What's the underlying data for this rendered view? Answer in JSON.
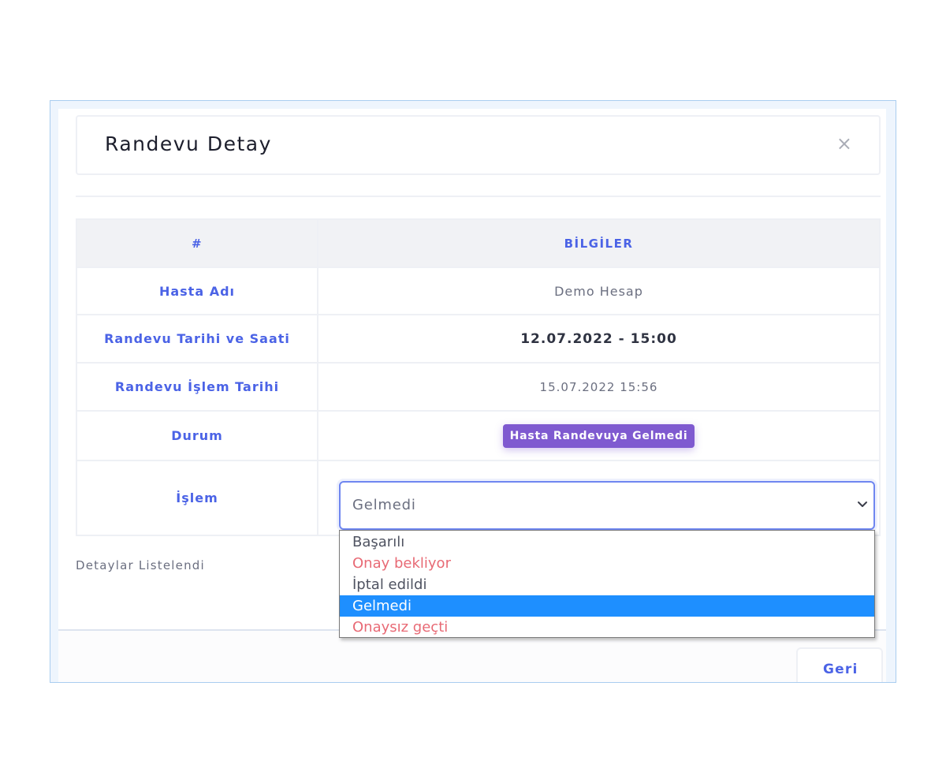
{
  "modal": {
    "title": "Randevu Detay",
    "close_label": "×",
    "footer_note": "Detaylar Listelendi",
    "back_label": "Geri"
  },
  "table": {
    "headers": [
      "#",
      "BİLGİLER"
    ],
    "rows": [
      {
        "key": "Hasta Adı",
        "value": "Demo Hesap"
      },
      {
        "key": "Randevu Tarihi ve Saati",
        "value": "12.07.2022 - 15:00"
      },
      {
        "key": "Randevu İşlem Tarihi",
        "value": "15.07.2022 15:56"
      },
      {
        "key": "Durum",
        "value": "Hasta Randevuya Gelmedi"
      },
      {
        "key": "İşlem",
        "value": ""
      }
    ]
  },
  "select": {
    "value": "Gelmedi",
    "options": [
      {
        "label": "Başarılı",
        "color": "#4f5361"
      },
      {
        "label": "Onay bekliyor",
        "color": "#e86a75"
      },
      {
        "label": "İptal edildi",
        "color": "#4f5361"
      },
      {
        "label": "Gelmedi",
        "color": "#ffffff"
      },
      {
        "label": "Onaysız geçti",
        "color": "#e86a75"
      }
    ]
  },
  "colors": {
    "accent": "#4b63e6",
    "badge": "#7f5ad0",
    "selected_option": "#1e8fff",
    "frame_border": "#a9cdf0"
  }
}
